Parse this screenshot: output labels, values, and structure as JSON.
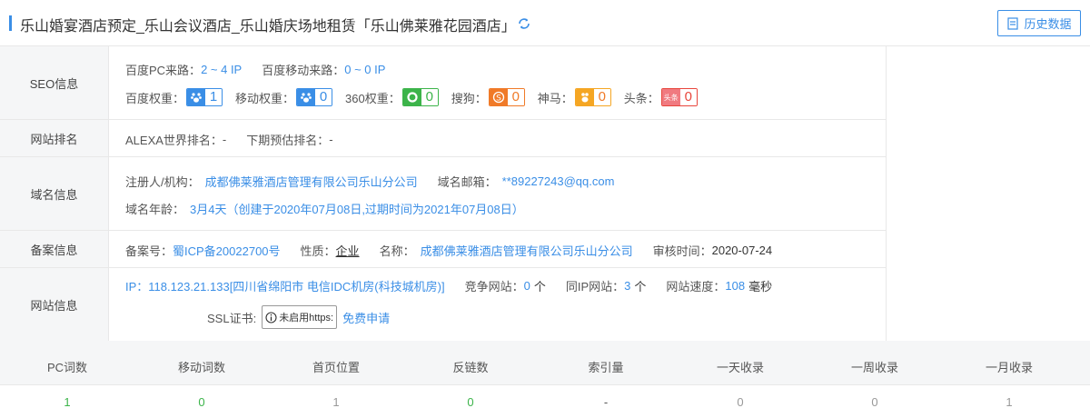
{
  "header": {
    "title": "乐山婚宴酒店预定_乐山会议酒店_乐山婚庆场地租赁「乐山佛莱雅花园酒店」",
    "history_button": "历史数据"
  },
  "seo": {
    "label": "SEO信息",
    "baidu_pc_key": "百度PC来路：",
    "baidu_pc_val": "2 ~ 4 IP",
    "baidu_mobile_key": "百度移动来路：",
    "baidu_mobile_val": "0 ~ 0 IP",
    "weights": [
      {
        "key": "百度权重：",
        "value": "1",
        "icon": "baidu-paw-icon"
      },
      {
        "key": "移动权重：",
        "value": "0",
        "icon": "baidu-paw-icon"
      },
      {
        "key": "360权重：",
        "value": "0",
        "icon": "360-icon"
      },
      {
        "key": "搜狗：",
        "value": "0",
        "icon": "sogou-icon"
      },
      {
        "key": "神马：",
        "value": "0",
        "icon": "shenma-icon"
      },
      {
        "key": "头条：",
        "value": "0",
        "icon": "toutiao-icon",
        "icon_text": "头条"
      }
    ]
  },
  "rank": {
    "label": "网站排名",
    "alexa_key": "ALEXA世界排名：",
    "alexa_val": "-",
    "next_key": "下期预估排名：",
    "next_val": "-"
  },
  "domain": {
    "label": "域名信息",
    "registrant_key": "注册人/机构：",
    "registrant_val": "成都佛莱雅酒店管理有限公司乐山分公司",
    "email_key": "域名邮箱：",
    "email_val": "**89227243@qq.com",
    "age_key": "域名年龄：",
    "age_val": "3月4天（创建于2020年07月08日,过期时间为2021年07月08日）"
  },
  "icp": {
    "label": "备案信息",
    "number_key": "备案号：",
    "number_val": "蜀ICP备20022700号",
    "nature_key": "性质：",
    "nature_val": "企业",
    "name_key": "名称：",
    "name_val": "成都佛莱雅酒店管理有限公司乐山分公司",
    "audit_key": "审核时间：",
    "audit_val": "2020-07-24"
  },
  "site": {
    "label": "网站信息",
    "ip_key": "IP：",
    "ip_val": "118.123.21.133[四川省绵阳市 电信IDC机房(科技城机房)]",
    "competitor_key": "竞争网站：",
    "competitor_val": "0",
    "competitor_unit": "个",
    "same_ip_key": "同IP网站：",
    "same_ip_val": "3",
    "same_ip_unit": "个",
    "speed_key": "网站速度：",
    "speed_val": "108",
    "speed_unit": "毫秒",
    "ssl_key": "SSL证书:",
    "ssl_badge": "未启用https:",
    "ssl_link": "免费申请"
  },
  "stats": {
    "headers": [
      "PC词数",
      "移动词数",
      "首页位置",
      "反链数",
      "索引量",
      "一天收录",
      "一周收录",
      "一月收录"
    ],
    "values": [
      "1",
      "0",
      "1",
      "0",
      "-",
      "0",
      "0",
      "1"
    ]
  },
  "colors": {
    "accent": "#3a8ee6",
    "green": "#3cb44a",
    "orange": "#f07a28",
    "red": "#e8463c"
  }
}
